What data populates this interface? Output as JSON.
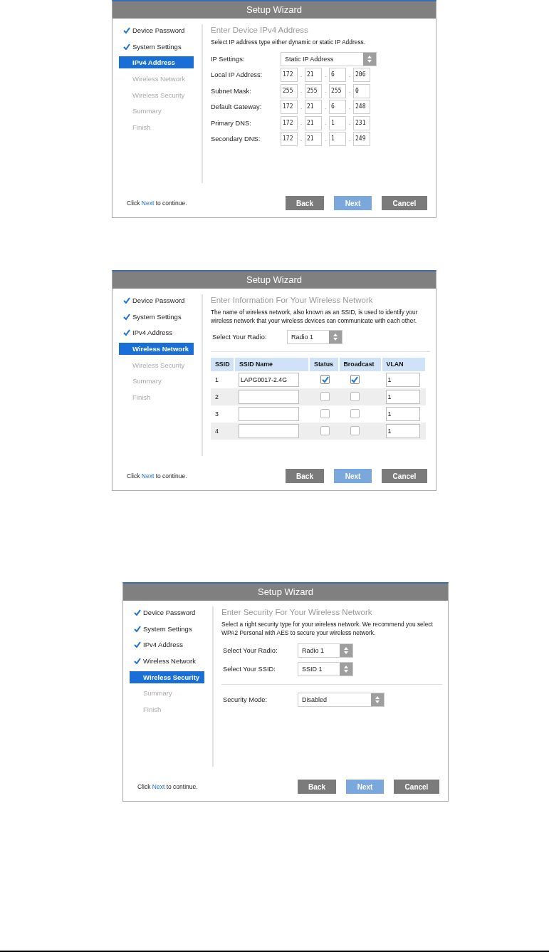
{
  "wizards": [
    {
      "title": "Setup Wizard",
      "steps": [
        {
          "label": "Device Password",
          "checked": true,
          "selected": false
        },
        {
          "label": "System Settings",
          "checked": true,
          "selected": false
        },
        {
          "label": "IPv4 Address",
          "checked": false,
          "selected": true
        },
        {
          "label": "Wireless Network",
          "checked": false,
          "selected": false
        },
        {
          "label": "Wireless Security",
          "checked": false,
          "selected": false
        },
        {
          "label": "Summary",
          "checked": false,
          "selected": false
        },
        {
          "label": "Finish",
          "checked": false,
          "selected": false
        }
      ],
      "heading": "Enter Device IPv4 Address",
      "description": "Select IP address type either dynamic or static IP Address.",
      "rows": [
        {
          "kind": "select",
          "label": "IP Settings:",
          "value": "Static IP Address"
        },
        {
          "kind": "ip",
          "label": "Local IP Address:",
          "octets": [
            "172",
            "21",
            "6",
            "206"
          ],
          "separators": [
            ".",
            ".",
            "."
          ]
        },
        {
          "kind": "ip",
          "label": "Subnet Mask:",
          "octets": [
            "255",
            "255",
            "255",
            "0"
          ],
          "separators": [
            ".",
            ".",
            "."
          ]
        },
        {
          "kind": "ip",
          "label": "Default Gateway:",
          "octets": [
            "172",
            "21",
            "6",
            "248"
          ],
          "separators": [
            ".",
            ".",
            "."
          ]
        },
        {
          "kind": "ip",
          "label": "Primary DNS:",
          "octets": [
            "172",
            "21",
            "1",
            "231"
          ],
          "separators": [
            ".",
            ".",
            "."
          ]
        },
        {
          "kind": "ip",
          "label": "Secondary DNS:",
          "octets": [
            "172",
            "21",
            "1",
            "249"
          ],
          "separators": [
            ".",
            ".",
            "."
          ]
        }
      ],
      "hint": {
        "before": "Click",
        "link": "Next",
        "after": "to continue."
      },
      "buttons": [
        {
          "label": "Back",
          "kind": "secondary"
        },
        {
          "label": "Next",
          "kind": "primary"
        },
        {
          "label": "Cancel",
          "kind": "secondary"
        }
      ]
    },
    {
      "title": "Setup Wizard",
      "steps": [
        {
          "label": "Device Password",
          "checked": true,
          "selected": false
        },
        {
          "label": "System Settings",
          "checked": true,
          "selected": false
        },
        {
          "label": "IPv4 Address",
          "checked": true,
          "selected": false
        },
        {
          "label": "Wireless Network",
          "checked": false,
          "selected": true
        },
        {
          "label": "Wireless Security",
          "checked": false,
          "selected": false
        },
        {
          "label": "Summary",
          "checked": false,
          "selected": false
        },
        {
          "label": "Finish",
          "checked": false,
          "selected": false
        }
      ],
      "heading": "Enter Information For Your Wireless Network",
      "description": "The name of wireless network, also known as an SSID, is used to identify your wireless network that your wireless devices can communicate with each other.",
      "rows": [
        {
          "kind": "select",
          "label": "Select Your Radio:",
          "value": "Radio 1"
        },
        {
          "kind": "divider"
        }
      ],
      "table": {
        "columns": [
          "SSID",
          "SSID Name",
          "Status",
          "Broadcast",
          "VLAN"
        ],
        "rows": [
          {
            "ssid": "1",
            "name": "LAPG0017-2.4G",
            "status": true,
            "broadcast": true,
            "vlan": "1"
          },
          {
            "ssid": "2",
            "status": false,
            "broadcast": false,
            "vlan": "1"
          },
          {
            "ssid": "3",
            "status": false,
            "broadcast": false,
            "vlan": "1"
          },
          {
            "ssid": "4",
            "status": false,
            "broadcast": false,
            "vlan": "1"
          }
        ]
      },
      "hint": {
        "before": "Click",
        "link": "Next",
        "after": "to continue."
      },
      "buttons": [
        {
          "label": "Back",
          "kind": "secondary"
        },
        {
          "label": "Next",
          "kind": "primary"
        },
        {
          "label": "Cancel",
          "kind": "secondary"
        }
      ]
    },
    {
      "title": "Setup Wizard",
      "steps": [
        {
          "label": "Device Password",
          "checked": true,
          "selected": false
        },
        {
          "label": "System Settings",
          "checked": true,
          "selected": false
        },
        {
          "label": "IPv4 Address",
          "checked": true,
          "selected": false
        },
        {
          "label": "Wireless Network",
          "checked": true,
          "selected": false
        },
        {
          "label": "Wireless Security",
          "checked": false,
          "selected": true
        },
        {
          "label": "Summary",
          "checked": false,
          "selected": false
        },
        {
          "label": "Finish",
          "checked": false,
          "selected": false
        }
      ],
      "heading": "Enter Security For Your Wireless Network",
      "description": "Select a right security type for your wireless network. We recommend you select WPA2 Personal with AES to secure your wireless network.",
      "rows": [
        {
          "kind": "select",
          "label": "Select Your Radio:",
          "value": "Radio 1"
        },
        {
          "kind": "select",
          "label": "Select Your SSID:",
          "value": "SSID 1"
        },
        {
          "kind": "divider"
        },
        {
          "kind": "select",
          "label": "Security Mode:",
          "value": "Disabled"
        }
      ],
      "hint": {
        "before": "Click",
        "link": "Next",
        "after": "to continue."
      },
      "buttons": [
        {
          "label": "Back",
          "kind": "secondary"
        },
        {
          "label": "Next",
          "kind": "primary"
        },
        {
          "label": "Cancel",
          "kind": "secondary"
        }
      ]
    }
  ]
}
